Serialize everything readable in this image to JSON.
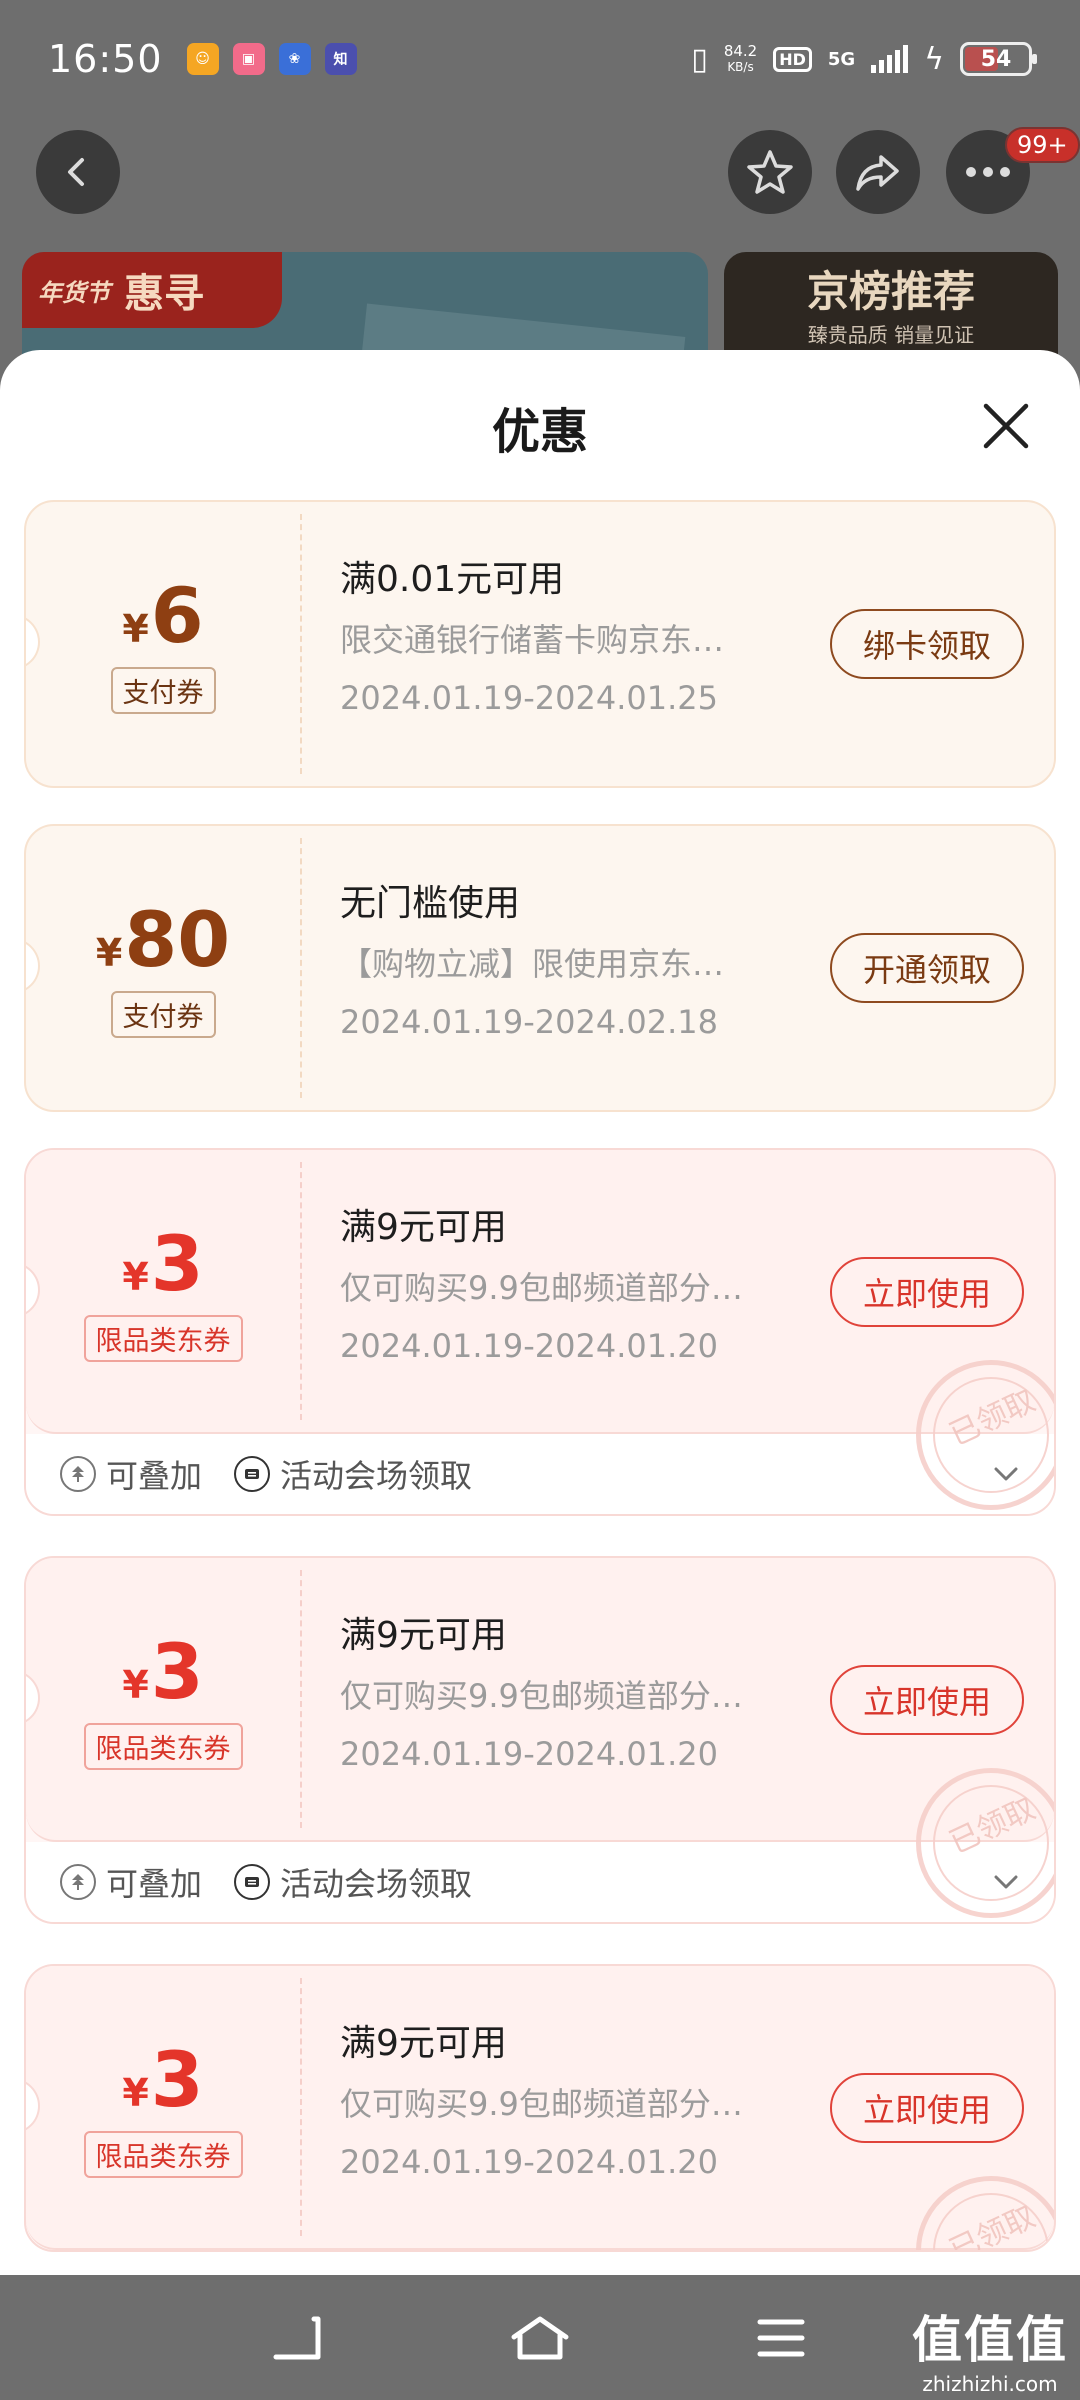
{
  "status_bar": {
    "time": "16:50",
    "net_speed_value": "84.2",
    "net_speed_unit": "KB/s",
    "hd": "HD",
    "network": "5G",
    "battery": "54",
    "notification_icons": [
      "taobao-app-icon",
      "bilibili-app-icon",
      "baidu-app-icon",
      "zhihu-app-icon"
    ]
  },
  "top_nav": {
    "badge": "99+",
    "icons": [
      "back-icon",
      "star-icon",
      "share-icon",
      "more-icon"
    ]
  },
  "background": {
    "banner_left_small": "年货节",
    "banner_left_title": "惠寻",
    "banner_right_title": "京榜推荐",
    "banner_right_sub": "臻贵品质 销量见证"
  },
  "sheet": {
    "title": "优惠",
    "close_icon": "close-icon"
  },
  "coupons": [
    {
      "style": "gold",
      "currency": "¥",
      "amount": "6",
      "type": "支付券",
      "condition": "满0.01元可用",
      "description": "限交通银行储蓄卡购京东…",
      "date_range": "2024.01.19-2024.01.25",
      "action": "绑卡领取"
    },
    {
      "style": "gold",
      "currency": "¥",
      "amount": "80",
      "type": "支付券",
      "condition": "无门槛使用",
      "description": "【购物立减】限使用京东…",
      "date_range": "2024.01.19-2024.02.18",
      "action": "开通领取"
    },
    {
      "style": "red",
      "currency": "¥",
      "amount": "3",
      "type": "限品类东券",
      "condition": "满9元可用",
      "description": "仅可购买9.9包邮频道部分…",
      "date_range": "2024.01.19-2024.01.20",
      "action": "立即使用",
      "stamp": "已领取",
      "feature_stackable": "可叠加",
      "feature_source": "活动会场领取"
    },
    {
      "style": "red",
      "currency": "¥",
      "amount": "3",
      "type": "限品类东券",
      "condition": "满9元可用",
      "description": "仅可购买9.9包邮频道部分…",
      "date_range": "2024.01.19-2024.01.20",
      "action": "立即使用",
      "stamp": "已领取",
      "feature_stackable": "可叠加",
      "feature_source": "活动会场领取"
    },
    {
      "style": "red",
      "currency": "¥",
      "amount": "3",
      "type": "限品类东券",
      "condition": "满9元可用",
      "description": "仅可购买9.9包邮频道部分…",
      "date_range": "2024.01.19-2024.01.20",
      "action": "立即使用",
      "stamp": "已领取"
    }
  ],
  "nav_bar": {
    "icons": [
      "back-nav-icon",
      "home-nav-icon",
      "menu-nav-icon"
    ]
  },
  "watermark": {
    "logo": "值值值",
    "url": "zhizhizhi.com"
  }
}
